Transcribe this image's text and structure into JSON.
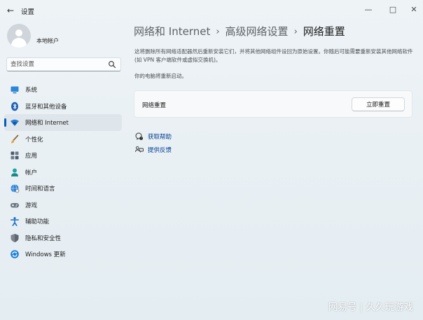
{
  "window": {
    "title": "设置",
    "back_icon": "back-arrow-icon",
    "controls": {
      "minimize": "—",
      "maximize": "□",
      "close": "✕"
    }
  },
  "user": {
    "name": "本地帐户"
  },
  "search": {
    "placeholder": "查找设置"
  },
  "sidebar": {
    "items": [
      {
        "label": "系统",
        "icon": "system-icon",
        "color": "#1e73c8",
        "active": false
      },
      {
        "label": "蓝牙和其他设备",
        "icon": "bluetooth-icon",
        "color": "#1b5fb6",
        "active": false
      },
      {
        "label": "网络和 Internet",
        "icon": "wifi-icon",
        "color": "#1b6fc6",
        "active": true
      },
      {
        "label": "个性化",
        "icon": "brush-icon",
        "color": "#e2a03a",
        "active": false
      },
      {
        "label": "应用",
        "icon": "apps-icon",
        "color": "#4a5b6b",
        "active": false
      },
      {
        "label": "帐户",
        "icon": "account-icon",
        "color": "#1fa5a0",
        "active": false
      },
      {
        "label": "时间和语言",
        "icon": "globe-clock-icon",
        "color": "#2a7fd4",
        "active": false
      },
      {
        "label": "游戏",
        "icon": "gamepad-icon",
        "color": "#6b7680",
        "active": false
      },
      {
        "label": "辅助功能",
        "icon": "accessibility-icon",
        "color": "#1b6fc6",
        "active": false
      },
      {
        "label": "隐私和安全性",
        "icon": "shield-icon",
        "color": "#7d868f",
        "active": false
      },
      {
        "label": "Windows 更新",
        "icon": "windows-update-icon",
        "color": "#1b7fd6",
        "active": false
      }
    ]
  },
  "breadcrumb": {
    "items": [
      "网络和 Internet",
      "高级网络设置"
    ],
    "current": "网络重置",
    "separator": "›"
  },
  "description": "这将删除所有网络适配器然后重新安装它们，并将其他网络组件设回为原始设置。你随后可能需要重新安装其他网络软件(如 VPN 客户端软件或虚拟交换机)。",
  "restart_note": "你的电脑将重新启动。",
  "reset_card": {
    "label": "网络重置",
    "button_label": "立即重置"
  },
  "help_links": [
    {
      "label": "获取帮助",
      "icon": "help-chat-icon"
    },
    {
      "label": "提供反馈",
      "icon": "feedback-icon"
    }
  ],
  "watermark": "网易号 | 久久玩游戏",
  "accent_color": "#005fb8"
}
